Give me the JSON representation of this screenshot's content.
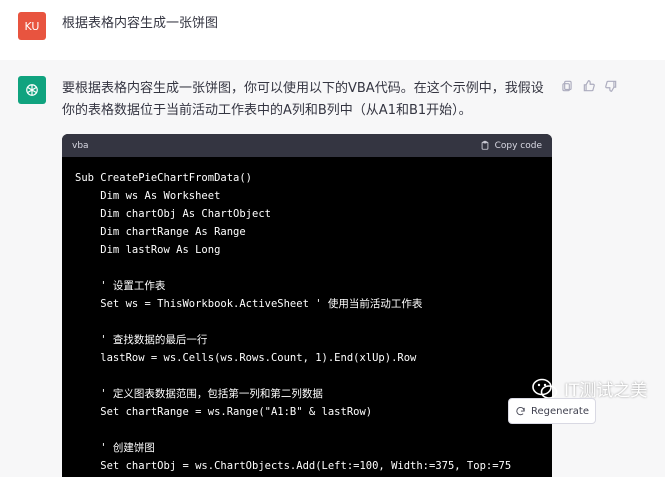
{
  "user_message": {
    "avatar_initials": "KU",
    "text": "根据表格内容生成一张饼图"
  },
  "assistant_message": {
    "text": "要根据表格内容生成一张饼图，你可以使用以下的VBA代码。在这个示例中，我假设你的表格数据位于当前活动工作表中的A列和B列中（从A1和B1开始）。",
    "code_block": {
      "language": "vba",
      "copy_label": "Copy code",
      "lines": [
        "Sub CreatePieChartFromData()",
        "    Dim ws As Worksheet",
        "    Dim chartObj As ChartObject",
        "    Dim chartRange As Range",
        "    Dim lastRow As Long",
        "",
        "    ' 设置工作表",
        "    Set ws = ThisWorkbook.ActiveSheet ' 使用当前活动工作表",
        "",
        "    ' 查找数据的最后一行",
        "    lastRow = ws.Cells(ws.Rows.Count, 1).End(xlUp).Row",
        "",
        "    ' 定义图表数据范围，包括第一列和第二列数据",
        "    Set chartRange = ws.Range(\"A1:B\" & lastRow)",
        "",
        "    ' 创建饼图",
        "    Set chartObj = ws.ChartObjects.Add(Left:=100, Width:=375, Top:=75"
      ]
    }
  },
  "regenerate_label": "Regenerate",
  "watermark_text": "IT测试之美",
  "colors": {
    "user_avatar": "#e8543f",
    "bot_avatar": "#10a37f",
    "code_bg": "#000000",
    "code_header_bg": "#343541"
  }
}
